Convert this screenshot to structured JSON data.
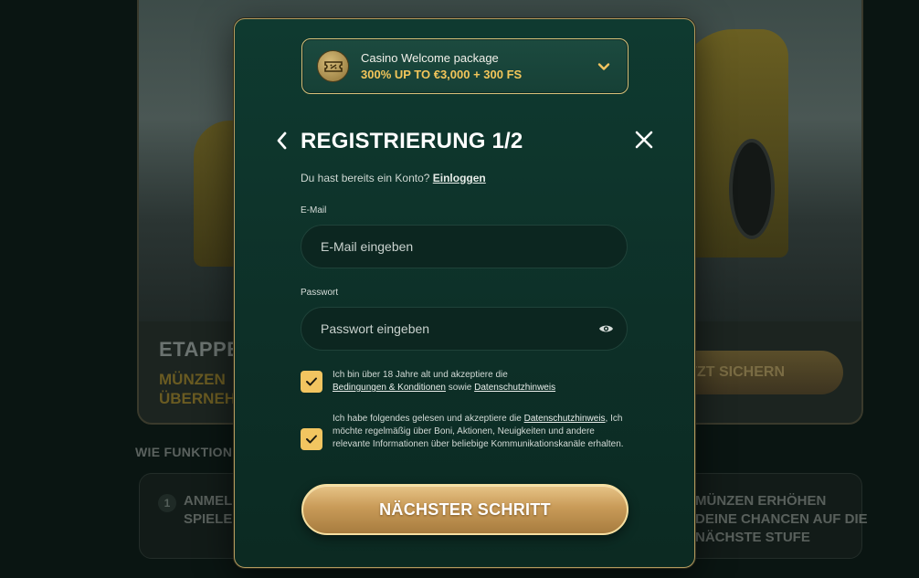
{
  "background": {
    "stage_title": "ETAPPE",
    "coins_text": "MÜNZEN ÜBERNEHMEN",
    "cta_label": "JETZT SICHERN",
    "how_title": "WIE FUNKTIONIERT ES",
    "step1_number": "1",
    "step1_text": "ANMELDEN SPIELEN",
    "step3_text": "MÜNZEN ERHÖHEN DEINE CHANCEN AUF DIE NÄCHSTE STUFE"
  },
  "modal": {
    "promo": {
      "title": "Casino Welcome package",
      "subtitle": "300% UP TO €3,000 + 300 FS",
      "icon": "ticket-coin-icon"
    },
    "title": "REGISTRIERUNG 1/2",
    "have_account_text": "Du hast bereits ein Konto?",
    "login_label": "Einloggen",
    "email": {
      "label": "E-Mail",
      "placeholder": "E-Mail eingeben",
      "value": ""
    },
    "password": {
      "label": "Passwort",
      "placeholder": "Passwort eingeben",
      "value": ""
    },
    "consent1": {
      "checked": true,
      "text_prefix": "Ich bin über 18 Jahre alt und akzeptiere die",
      "terms_link": "Bedingungen & Konditionen",
      "middle": "sowie",
      "privacy_link": "Datenschutzhinweis"
    },
    "consent2": {
      "checked": true,
      "text_prefix": "Ich habe folgendes gelesen und akzeptiere die",
      "privacy_link": "Datenschutzhinweis",
      "text_suffix": ", Ich möchte regelmäßig über Boni, Aktionen, Neuigkeiten und andere relevante Informationen über beliebige Kommunikationskanäle erhalten."
    },
    "next_button": "NÄCHSTER SCHRITT"
  },
  "colors": {
    "accent_gold": "#f2c560",
    "modal_bg": "#0f3a30",
    "button_gold": "#c99b58"
  }
}
